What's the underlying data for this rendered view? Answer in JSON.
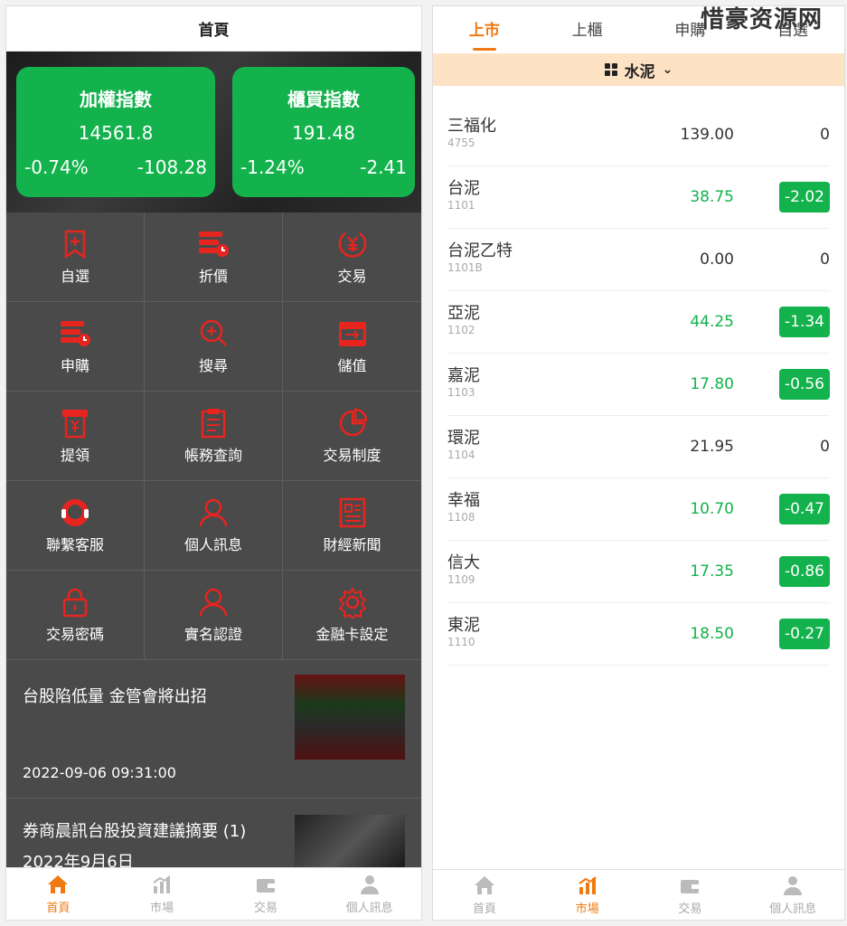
{
  "left": {
    "header_title": "首頁",
    "indices": [
      {
        "title": "加權指數",
        "value": "14561.8",
        "pct": "-0.74%",
        "chg": "-108.28"
      },
      {
        "title": "櫃買指數",
        "value": "191.48",
        "pct": "-1.24%",
        "chg": "-2.41"
      }
    ],
    "menu": [
      {
        "label": "自選",
        "icon": "bookmark-icon"
      },
      {
        "label": "折價",
        "icon": "discount-icon"
      },
      {
        "label": "交易",
        "icon": "currency-icon"
      },
      {
        "label": "申購",
        "icon": "subscribe-icon"
      },
      {
        "label": "搜尋",
        "icon": "search-icon"
      },
      {
        "label": "儲值",
        "icon": "wallet-icon"
      },
      {
        "label": "提領",
        "icon": "withdraw-icon"
      },
      {
        "label": "帳務查詢",
        "icon": "clipboard-icon"
      },
      {
        "label": "交易制度",
        "icon": "pie-chart-icon"
      },
      {
        "label": "聯繫客服",
        "icon": "headset-icon"
      },
      {
        "label": "個人訊息",
        "icon": "user-icon"
      },
      {
        "label": "財經新聞",
        "icon": "news-icon"
      },
      {
        "label": "交易密碼",
        "icon": "lock-icon"
      },
      {
        "label": "實名認證",
        "icon": "user-icon"
      },
      {
        "label": "金融卡設定",
        "icon": "gear-icon"
      }
    ],
    "news": [
      {
        "title": "台股陷低量 金管會將出招",
        "date": "2022-09-06 09:31:00"
      },
      {
        "title": "券商晨訊台股投資建議摘要 (1) 2022年9月6日"
      }
    ]
  },
  "right": {
    "watermark": "惜豪资源网",
    "tabs": [
      "上市",
      "上櫃",
      "申購",
      "自選"
    ],
    "category": "水泥",
    "stocks": [
      {
        "name": "三福化",
        "code": "4755",
        "price": "139.00",
        "change": "0"
      },
      {
        "name": "台泥",
        "code": "1101",
        "price": "38.75",
        "change": "-2.02"
      },
      {
        "name": "台泥乙特",
        "code": "1101B",
        "price": "0.00",
        "change": "0"
      },
      {
        "name": "亞泥",
        "code": "1102",
        "price": "44.25",
        "change": "-1.34"
      },
      {
        "name": "嘉泥",
        "code": "1103",
        "price": "17.80",
        "change": "-0.56"
      },
      {
        "name": "環泥",
        "code": "1104",
        "price": "21.95",
        "change": "0"
      },
      {
        "name": "幸福",
        "code": "1108",
        "price": "10.70",
        "change": "-0.47"
      },
      {
        "name": "信大",
        "code": "1109",
        "price": "17.35",
        "change": "-0.86"
      },
      {
        "name": "東泥",
        "code": "1110",
        "price": "18.50",
        "change": "-0.27"
      }
    ]
  },
  "tabbar": [
    "首頁",
    "市場",
    "交易",
    "個人訊息"
  ],
  "colors": {
    "accent": "#f07a12",
    "green": "#13b24c",
    "icon_red": "#e8241f"
  }
}
